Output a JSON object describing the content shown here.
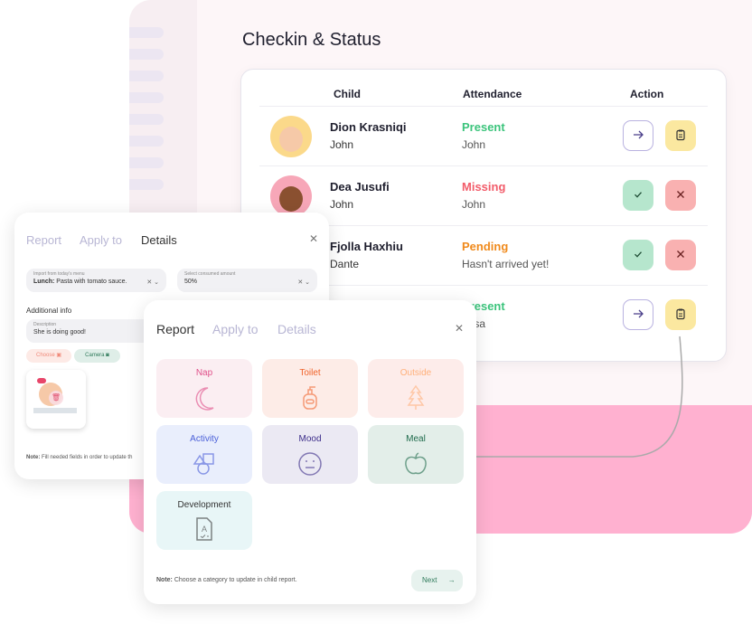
{
  "page": {
    "title": "Checkin & Status"
  },
  "table": {
    "headers": {
      "child": "Child",
      "attendance": "Attendance",
      "action": "Action"
    },
    "rows": [
      {
        "name": "Dion Krasniqi",
        "guardian": "John",
        "status": "Present",
        "status_detail": "John",
        "status_color": "#3cc47c",
        "actions": [
          "arrow-right",
          "clipboard"
        ]
      },
      {
        "name": "Dea Jusufi",
        "guardian": "John",
        "status": "Missing",
        "status_detail": "John",
        "status_color": "#f25c6a",
        "actions": [
          "check",
          "close"
        ]
      },
      {
        "name": "Fjolla Haxhiu",
        "guardian": "Dante",
        "status": "Pending",
        "status_detail": "Hasn't arrived yet!",
        "status_color": "#f08a1c",
        "actions": [
          "check",
          "close"
        ]
      },
      {
        "name": "",
        "guardian": "",
        "status": "Present",
        "status_detail": "Elisa",
        "status_color": "#3cc47c",
        "actions": [
          "arrow-right",
          "clipboard"
        ]
      }
    ]
  },
  "details_modal": {
    "tabs": [
      "Report",
      "Apply to",
      "Details"
    ],
    "active_tab": "Details",
    "menu_field": {
      "label": "Import from today's menu",
      "value_bold": "Lunch:",
      "value": "Pasta with tomato sauce."
    },
    "amount_field": {
      "label": "Select consumed amount",
      "value": "50%"
    },
    "additional_info": "Additional info",
    "description": {
      "label": "Description",
      "value": "She is doing good!"
    },
    "choose_label": "Choose",
    "camera_label": "Camera",
    "note_bold": "Note:",
    "note": "Fill needed fields in order to update th"
  },
  "report_modal": {
    "tabs": [
      "Report",
      "Apply to",
      "Details"
    ],
    "active_tab": "Report",
    "categories": [
      {
        "label": "Nap",
        "icon": "moon-icon",
        "color": "#e0508a",
        "bg": "#fbeef2"
      },
      {
        "label": "Toilet",
        "icon": "soap-icon",
        "color": "#f0632a",
        "bg": "#fdece7"
      },
      {
        "label": "Outside",
        "icon": "tree-icon",
        "color": "#ffb07a",
        "bg": "#fdecea"
      },
      {
        "label": "Activity",
        "icon": "shapes-icon",
        "color": "#4a5fd8",
        "bg": "#e9eefc"
      },
      {
        "label": "Mood",
        "icon": "neutral-face-icon",
        "color": "#3d2e8a",
        "bg": "#ebe9f3"
      },
      {
        "label": "Meal",
        "icon": "apple-icon",
        "color": "#1f6b4c",
        "bg": "#e3eee9"
      },
      {
        "label": "Development",
        "icon": "report-file-icon",
        "color": "#333333",
        "bg": "#e8f6f7"
      }
    ],
    "note_bold": "Note:",
    "note": "Choose a category to update in child report.",
    "next_label": "Next"
  }
}
